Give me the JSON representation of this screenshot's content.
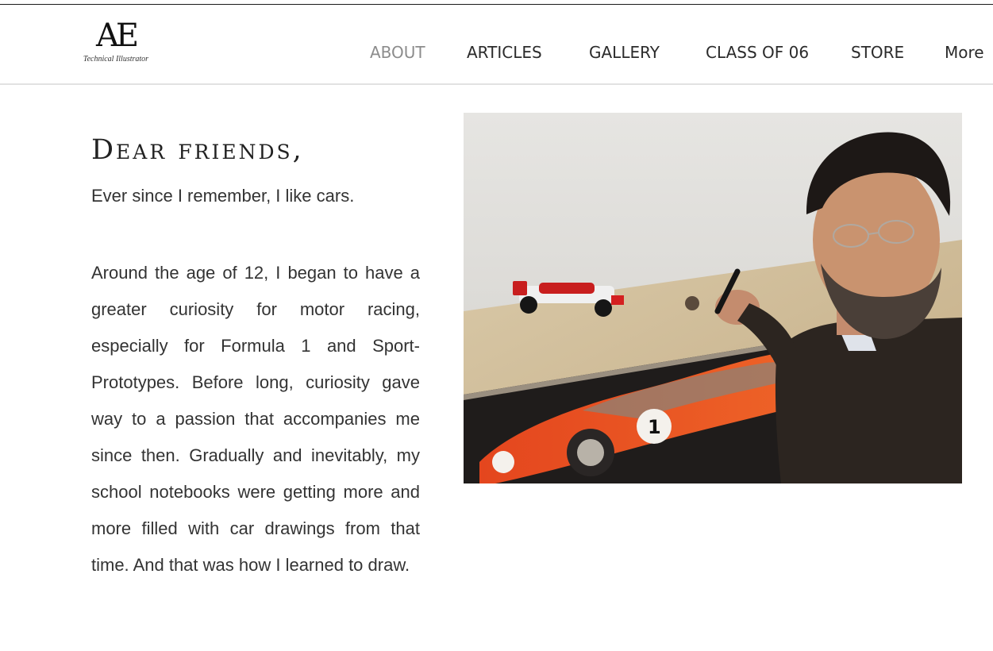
{
  "header": {
    "logo_mark": "AE",
    "logo_subtitle": "Technical Illustrator",
    "nav": [
      {
        "label": "ABOUT",
        "active": true
      },
      {
        "label": "ARTICLES",
        "active": false
      },
      {
        "label": "GALLERY",
        "active": false
      },
      {
        "label": "CLASS OF 06",
        "active": false
      },
      {
        "label": "STORE",
        "active": false
      },
      {
        "label": "More",
        "active": false
      }
    ]
  },
  "main": {
    "title": "Dear friends,",
    "lead": "Ever since I remember, I like cars.",
    "body": "Around the age of 12, I began to have a greater curiosity for motor racing, especially for Formula 1 and Sport-Prototypes. Before long, curiosity gave way to a passion that accompanies me since then. Gradually and inevitably, my school notebooks were getting more and more filled with car drawings from that time. And that was how I learned to draw."
  },
  "colors": {
    "nav_text": "#2b2b2b",
    "nav_active": "#8c8c8c",
    "body_text": "#333333",
    "divider": "#e2e2e2"
  }
}
